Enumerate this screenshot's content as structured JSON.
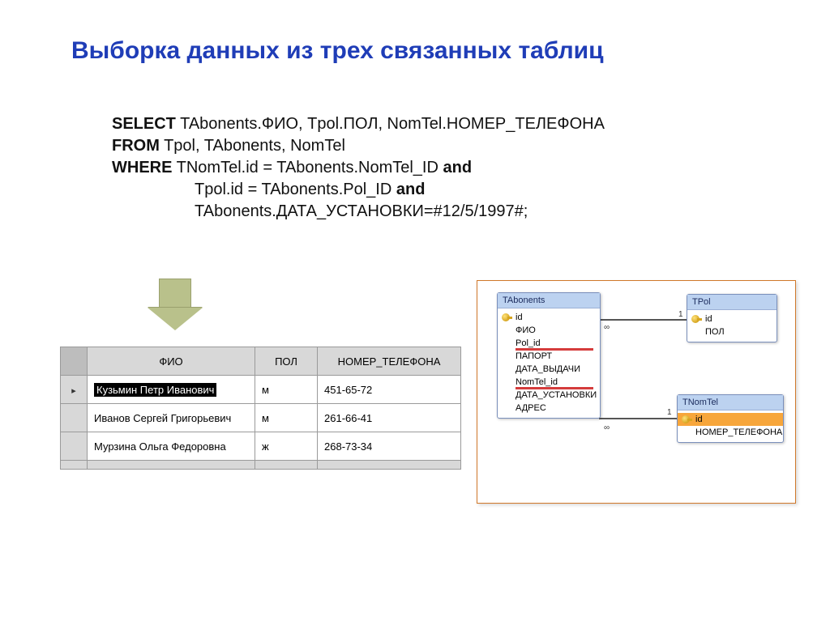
{
  "title": "Выборка данных из трех связанных таблиц",
  "sql": {
    "select_kw": "SELECT",
    "select_fields": " TAbonents.ФИО, Tpol.ПОЛ, NomTel.НОМЕР_ТЕЛЕФОНА",
    "from_kw": "FROM",
    "from_tables": " Tpol, TAbonents, NomTel",
    "where_kw": "WHERE",
    "cond1": " TNomTel.id = TAbonents.NomTel_ID ",
    "and1": "and",
    "cond2": "Tpol.id = TAbonents.Pol_ID ",
    "and2": "and",
    "cond3": "TAbonents.ДАТА_УСТАНОВКИ=#12/5/1997#;"
  },
  "result": {
    "headers": [
      "ФИО",
      "ПОЛ",
      "НОМЕР_ТЕЛЕФОНА"
    ],
    "rows": [
      {
        "fio": "Кузьмин Петр Иванович",
        "pol": "м",
        "tel": "451-65-72"
      },
      {
        "fio": "Иванов Сергей Григорьевич",
        "pol": "м",
        "tel": "261-66-41"
      },
      {
        "fio": "Мурзина Ольга Федоровна",
        "pol": "ж",
        "tel": "268-73-34"
      }
    ]
  },
  "schema": {
    "tabonents": {
      "title": "TAbonents",
      "fields": [
        "id",
        "ФИО",
        "Pol_id",
        "ПАПОРТ",
        "ДАТА_ВЫДАЧИ",
        "NomTel_id",
        "ДАТА_УСТАНОВКИ",
        "АДРЕС"
      ]
    },
    "tpol": {
      "title": "TPol",
      "fields": [
        "id",
        "ПОЛ"
      ]
    },
    "tnomtel": {
      "title": "TNomTel",
      "fields": [
        "id",
        "НОМЕР_ТЕЛЕФОНА"
      ]
    },
    "card": {
      "one": "1",
      "many": "∞"
    }
  }
}
